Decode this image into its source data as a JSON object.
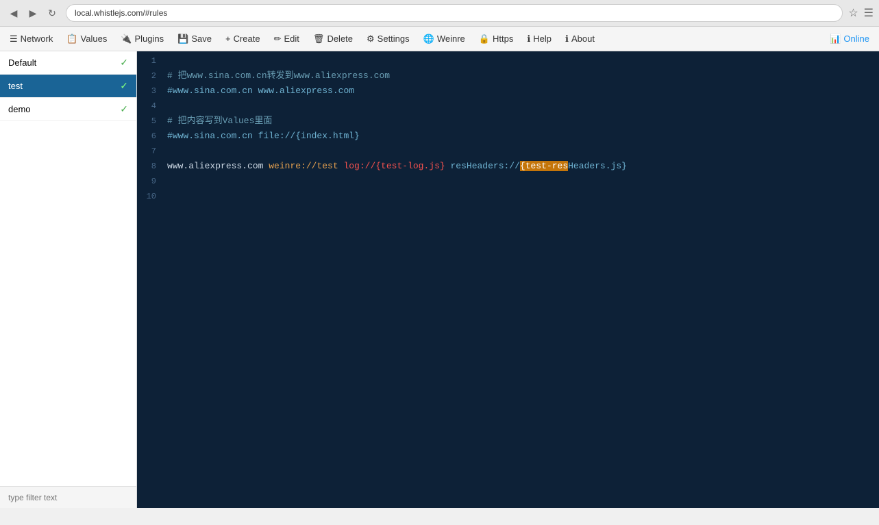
{
  "browser": {
    "url": "local.whistlejs.com/#rules",
    "back_icon": "◀",
    "forward_icon": "▶",
    "reload_icon": "↻"
  },
  "navbar": {
    "items": [
      {
        "id": "network",
        "icon": "☰",
        "label": "Network"
      },
      {
        "id": "values",
        "icon": "📋",
        "label": "Values"
      },
      {
        "id": "plugins",
        "icon": "🔌",
        "label": "Plugins"
      },
      {
        "id": "save",
        "icon": "💾",
        "label": "Save"
      },
      {
        "id": "create",
        "icon": "+",
        "label": "Create"
      },
      {
        "id": "edit",
        "icon": "✏️",
        "label": "Edit"
      },
      {
        "id": "delete",
        "icon": "🗑",
        "label": "Delete"
      },
      {
        "id": "settings",
        "icon": "⚙",
        "label": "Settings"
      },
      {
        "id": "weinre",
        "icon": "🌐",
        "label": "Weinre"
      },
      {
        "id": "https",
        "icon": "🔒",
        "label": "Https"
      },
      {
        "id": "help",
        "icon": "ℹ",
        "label": "Help"
      },
      {
        "id": "about",
        "icon": "ℹ",
        "label": "About"
      }
    ],
    "online_label": "Online"
  },
  "sidebar": {
    "items": [
      {
        "id": "default",
        "name": "Default",
        "active": false,
        "checked": true
      },
      {
        "id": "test",
        "name": "test",
        "active": true,
        "checked": true
      },
      {
        "id": "demo",
        "name": "demo",
        "active": false,
        "checked": true
      }
    ],
    "filter_placeholder": "type filter text"
  },
  "editor": {
    "lines": [
      {
        "num": 1,
        "content": ""
      },
      {
        "num": 2,
        "content": "comment_1",
        "type": "comment",
        "text": "# 把www.sina.com.cn转发到www.aliexpress.com"
      },
      {
        "num": 3,
        "content": "rule_1",
        "type": "rule_blue",
        "text": "#www.sina.com.cn www.aliexpress.com"
      },
      {
        "num": 4,
        "content": ""
      },
      {
        "num": 5,
        "content": "comment_2",
        "type": "comment",
        "text": "# 把内容写到Values里面"
      },
      {
        "num": 6,
        "content": "rule_2",
        "type": "rule_blue",
        "text": "#www.sina.com.cn file://{index.html}"
      },
      {
        "num": 7,
        "content": ""
      },
      {
        "num": 8,
        "content": "rule_3",
        "type": "complex"
      },
      {
        "num": 9,
        "content": ""
      },
      {
        "num": 10,
        "content": ""
      }
    ]
  }
}
